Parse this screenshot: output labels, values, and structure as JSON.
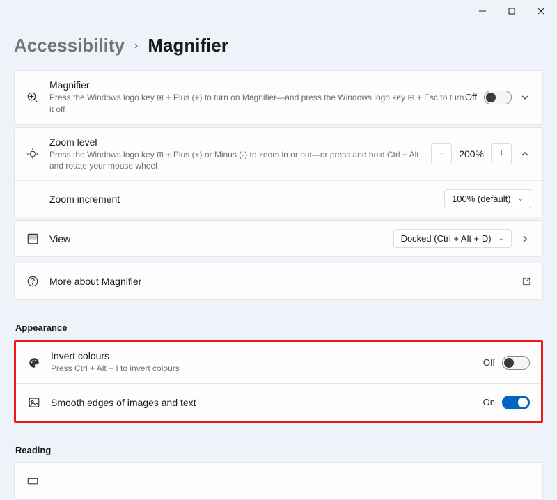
{
  "window": {
    "minimize_icon": "minimize-icon",
    "maximize_icon": "maximize-icon",
    "close_icon": "close-icon"
  },
  "breadcrumb": {
    "parent": "Accessibility",
    "current": "Magnifier"
  },
  "magnifier": {
    "title": "Magnifier",
    "subtitle_a": "Press the Windows logo key ",
    "subtitle_b": " + Plus (+) to turn on Magnifier—and press the Windows logo key ",
    "subtitle_c": " + Esc to turn it off",
    "state_label": "Off"
  },
  "zoom_level": {
    "title": "Zoom level",
    "subtitle_a": "Press the Windows logo key ",
    "subtitle_b": " + Plus (+) or Minus (-) to zoom in or out—or press and hold Ctrl + Alt and rotate your mouse wheel",
    "value": "200%"
  },
  "zoom_increment": {
    "title": "Zoom increment",
    "value": "100% (default)"
  },
  "view": {
    "title": "View",
    "value": "Docked (Ctrl + Alt + D)"
  },
  "more": {
    "title": "More about Magnifier"
  },
  "appearance": {
    "header": "Appearance",
    "invert": {
      "title": "Invert colours",
      "subtitle": "Press Ctrl + Alt + I to invert colours",
      "state_label": "Off"
    },
    "smooth": {
      "title": "Smooth edges of images and text",
      "state_label": "On"
    }
  },
  "reading": {
    "header": "Reading"
  }
}
